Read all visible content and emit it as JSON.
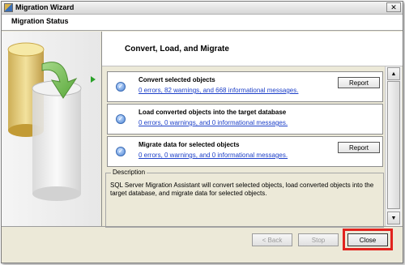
{
  "window": {
    "title": "Migration Wizard",
    "close_glyph": "✕"
  },
  "header": {
    "title": "Migration Status"
  },
  "sidebar": {
    "graphic_icon": "database-cylinders-with-arrow",
    "current_step_icon": "green-arrow-icon"
  },
  "step": {
    "title": "Convert, Load, and Migrate"
  },
  "tasks": [
    {
      "title": "Convert selected objects",
      "summary": "0 errors, 82 warnings, and 668 informational messages.",
      "report_label": "Report",
      "status_icon": "check-circle-icon"
    },
    {
      "title": "Load converted objects into the target database",
      "summary": "0 errors, 0 warnings, and 0 informational messages.",
      "status_icon": "check-circle-icon"
    },
    {
      "title": "Migrate data for selected objects",
      "summary": "0 errors, 0 warnings, and 0 informational messages.",
      "report_label": "Report",
      "status_icon": "check-circle-icon"
    }
  ],
  "description": {
    "label": "Description",
    "text": "SQL Server Migration Assistant will convert selected objects, load converted objects into the target database, and migrate data for selected objects."
  },
  "scrollbar": {
    "up_glyph": "▲",
    "down_glyph": "▼"
  },
  "buttons": {
    "back": "< Back",
    "stop": "Stop",
    "close": "Close"
  },
  "colors": {
    "highlight": "#e1231e",
    "link": "#1c3fc8",
    "current_step_arrow": "#2aa12a"
  }
}
